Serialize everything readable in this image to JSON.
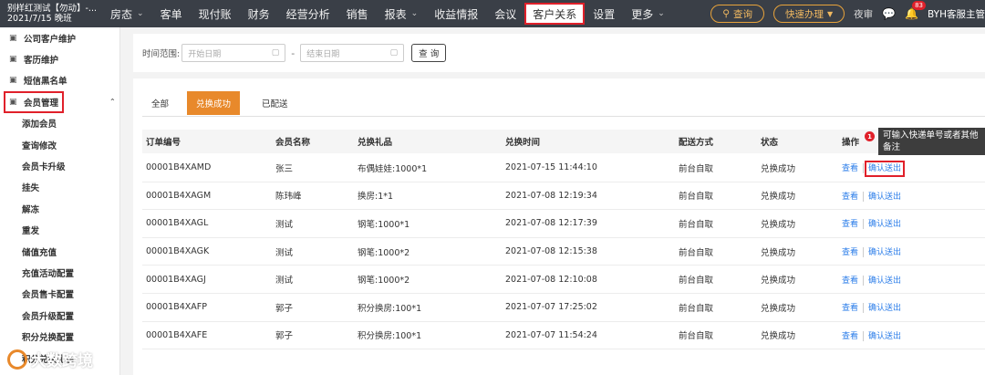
{
  "header": {
    "brand_line1": "别样红测试【勿动】-...",
    "brand_line2": "2021/7/15 晚班",
    "menu": [
      {
        "label": "房态",
        "chev": true
      },
      {
        "label": "客单",
        "chev": false
      },
      {
        "label": "现付账",
        "chev": false
      },
      {
        "label": "财务",
        "chev": false
      },
      {
        "label": "经营分析",
        "chev": false
      },
      {
        "label": "销售",
        "chev": false
      },
      {
        "label": "报表",
        "chev": true
      },
      {
        "label": "收益情报",
        "chev": false
      },
      {
        "label": "会议",
        "chev": false
      },
      {
        "label": "客户关系",
        "chev": false,
        "active": true
      },
      {
        "label": "设置",
        "chev": false
      },
      {
        "label": "更多",
        "chev": true
      }
    ],
    "search_label": "查询",
    "quick_label": "快速办理",
    "night_label": "夜审",
    "notif_count": "83",
    "user_label": "BYH客服主管"
  },
  "sidebar": {
    "items": [
      {
        "label": "公司客户维护",
        "type": "group"
      },
      {
        "label": "客历维护",
        "type": "group"
      },
      {
        "label": "短信黑名单",
        "type": "group"
      },
      {
        "label": "会员管理",
        "type": "group",
        "expanded": true
      },
      {
        "label": "添加会员",
        "type": "sub"
      },
      {
        "label": "查询修改",
        "type": "sub"
      },
      {
        "label": "会员卡升级",
        "type": "sub"
      },
      {
        "label": "挂失",
        "type": "sub"
      },
      {
        "label": "解冻",
        "type": "sub"
      },
      {
        "label": "重发",
        "type": "sub"
      },
      {
        "label": "储值充值",
        "type": "sub"
      },
      {
        "label": "充值活动配置",
        "type": "sub"
      },
      {
        "label": "会员售卡配置",
        "type": "sub"
      },
      {
        "label": "会员升级配置",
        "type": "sub"
      },
      {
        "label": "积分兑换配置",
        "type": "sub"
      },
      {
        "label": "积分兑换礼品",
        "type": "sub"
      }
    ]
  },
  "filter": {
    "time_label": "时间范围:",
    "start_placeholder": "开始日期",
    "end_placeholder": "结束日期",
    "dash": "-",
    "query_label": "查 询"
  },
  "tabs": [
    {
      "label": "全部"
    },
    {
      "label": "兑换成功",
      "active": true
    },
    {
      "label": "已配送"
    }
  ],
  "table": {
    "headers": [
      "订单编号",
      "会员名称",
      "兑换礼品",
      "兑换时间",
      "配送方式",
      "状态",
      "操作"
    ],
    "view_label": "查看",
    "confirm_label": "确认送出",
    "rows": [
      [
        "00001B4XAMD",
        "张三",
        "布偶娃娃:1000*1",
        "2021-07-15 11:44:10",
        "前台自取",
        "兑换成功"
      ],
      [
        "00001B4XAGM",
        "陈玮峰",
        "换房:1*1",
        "2021-07-08 12:19:34",
        "前台自取",
        "兑换成功"
      ],
      [
        "00001B4XAGL",
        "测试",
        "钢笔:1000*1",
        "2021-07-08 12:17:39",
        "前台自取",
        "兑换成功"
      ],
      [
        "00001B4XAGK",
        "测试",
        "钢笔:1000*2",
        "2021-07-08 12:15:38",
        "前台自取",
        "兑换成功"
      ],
      [
        "00001B4XAGJ",
        "测试",
        "钢笔:1000*2",
        "2021-07-08 12:10:08",
        "前台自取",
        "兑换成功"
      ],
      [
        "00001B4XAFP",
        "郭子",
        "积分换房:100*1",
        "2021-07-07 17:25:02",
        "前台自取",
        "兑换成功"
      ],
      [
        "00001B4XAFE",
        "郭子",
        "积分换房:100*1",
        "2021-07-07 11:54:24",
        "前台自取",
        "兑换成功"
      ]
    ]
  },
  "tooltip": {
    "number": "1",
    "text": "可输入快递单号或者其他备注"
  },
  "watermark": {
    "text": "大数跨境"
  },
  "colors": {
    "topbar": "#3a3f47",
    "accent_orange": "#e8892b",
    "highlight_red": "#e0202a",
    "link_blue": "#2b7de9"
  }
}
